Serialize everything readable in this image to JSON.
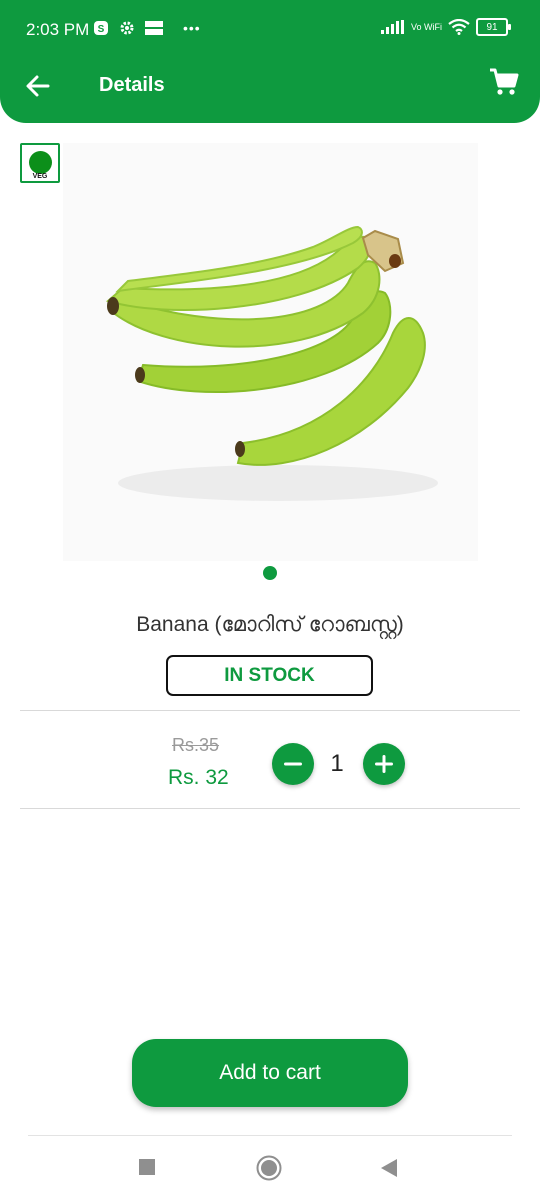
{
  "status_bar": {
    "time": "2:03 PM",
    "network_label": "Vo WiFi",
    "battery": "91"
  },
  "toolbar": {
    "title": "Details",
    "back_icon": "arrow-left-icon",
    "cart_icon": "shopping-cart-icon"
  },
  "product": {
    "veg_label": "VEG",
    "name": "Banana (മോറിസ് റോബസ്റ്റ)",
    "stock_status": "IN STOCK",
    "old_price": "Rs.35",
    "price": "Rs. 32",
    "quantity": "1",
    "image_icon": "banana-image",
    "image_page": 1,
    "image_pages": 1
  },
  "actions": {
    "add_to_cart": "Add to cart"
  },
  "nav": {
    "recents_icon": "square-icon",
    "home_icon": "circle-icon",
    "back_icon": "triangle-back-icon"
  },
  "colors": {
    "brand_green": "#0e9a3f",
    "veg_green": "#0c8f1a",
    "banana_green": "#a6d33a"
  }
}
